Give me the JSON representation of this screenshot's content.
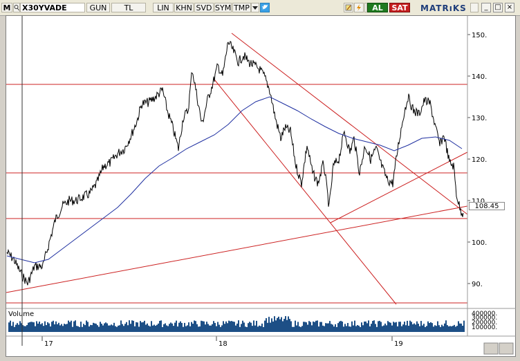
{
  "toolbar": {
    "menu_letter": "M",
    "symbol": "X30YVADE",
    "period": "GUN",
    "currency": "TL",
    "scale": "LIN",
    "items": [
      "KHN",
      "SVD",
      "SYM",
      "TMP"
    ],
    "buy_label": "AL",
    "sell_label": "SAT",
    "brand": "MATRıKS",
    "icons": [
      "search-icon",
      "dropdown-icon",
      "twitter-icon",
      "edit-icon",
      "refresh-icon",
      "settings-icon",
      "minimize-icon",
      "maximize-icon",
      "close-icon"
    ]
  },
  "chart": {
    "y_ticks": [
      "150.",
      "140.",
      "130.",
      "120.",
      "110.",
      "100.",
      "90."
    ],
    "last_price": "108.45",
    "x_labels": [
      "17",
      "18",
      "19"
    ],
    "volume_label": "Volume",
    "volume_ticks": [
      "400000.",
      "300000.",
      "200000.",
      "100000."
    ],
    "colors": {
      "price": "#000000",
      "ma": "#1e2fa0",
      "trend": "#cc2020",
      "volume": "#1d4f86"
    }
  }
}
